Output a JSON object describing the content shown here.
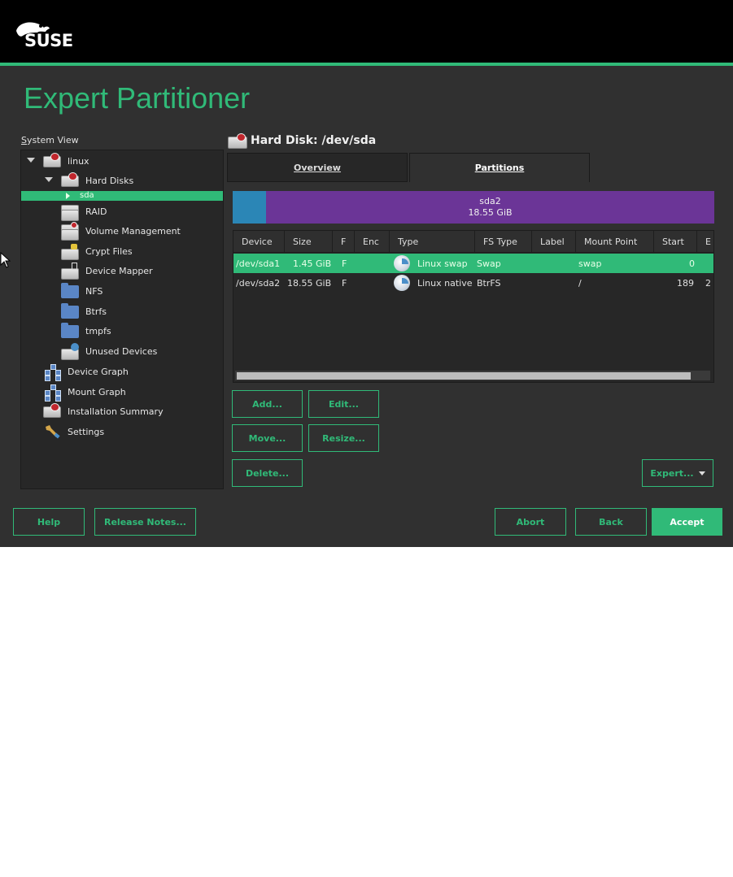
{
  "banner": {
    "logo_text": "SUSE"
  },
  "page_title": "Expert Partitioner",
  "system_view": {
    "label": "System View",
    "tree": [
      {
        "label": "linux"
      },
      {
        "label": "Hard Disks"
      },
      {
        "label": "sda"
      },
      {
        "label": "RAID"
      },
      {
        "label": "Volume Management"
      },
      {
        "label": "Crypt Files"
      },
      {
        "label": "Device Mapper"
      },
      {
        "label": "NFS"
      },
      {
        "label": "Btrfs"
      },
      {
        "label": "tmpfs"
      },
      {
        "label": "Unused Devices"
      },
      {
        "label": "Device Graph"
      },
      {
        "label": "Mount Graph"
      },
      {
        "label": "Installation Summary"
      },
      {
        "label": "Settings"
      }
    ]
  },
  "disk_header": "Hard Disk: /dev/sda",
  "tabs": [
    {
      "label": "Overview"
    },
    {
      "label": "Partitions"
    }
  ],
  "partition_bar": {
    "sda2_name": "sda2",
    "sda2_size": "18.55 GiB",
    "colors": {
      "sda1": "#2b86b6",
      "sda2": "#6b3597"
    }
  },
  "table": {
    "headers": [
      "Device",
      "Size",
      "F",
      "Enc",
      "Type",
      "FS Type",
      "Label",
      "Mount Point",
      "Start",
      "E"
    ],
    "rows": [
      {
        "device": "/dev/sda1",
        "size": "1.45 GiB",
        "f": "F",
        "enc": "",
        "type": "Linux swap",
        "fs_type": "Swap",
        "label": "",
        "mount_point": "swap",
        "start": "0",
        "end": ""
      },
      {
        "device": "/dev/sda2",
        "size": "18.55 GiB",
        "f": "F",
        "enc": "",
        "type": "Linux native",
        "fs_type": "BtrFS",
        "label": "",
        "mount_point": "/",
        "start": "189",
        "end": "2"
      }
    ]
  },
  "actions": {
    "add": "Add...",
    "edit": "Edit...",
    "move": "Move...",
    "resize": "Resize...",
    "delete": "Delete...",
    "expert": "Expert..."
  },
  "footer": {
    "help": "Help",
    "release_notes": "Release Notes...",
    "abort": "Abort",
    "back": "Back",
    "accept": "Accept"
  },
  "colors": {
    "accent": "#30ba78",
    "background": "#303030",
    "banner": "#000000"
  }
}
